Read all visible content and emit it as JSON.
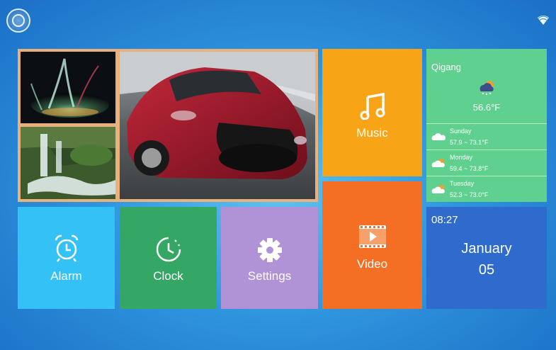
{
  "status_bar": {
    "home_icon": "circle-button-icon",
    "wifi_icon": "wifi-icon"
  },
  "gallery": {
    "photos": [
      "water-splash",
      "waterfall",
      "red-sports-car"
    ]
  },
  "tiles": {
    "music": {
      "label": "Music",
      "icon": "music-note-icon",
      "color": "#f7a416"
    },
    "video": {
      "label": "Video",
      "icon": "film-play-icon",
      "color": "#f46f24"
    },
    "alarm": {
      "label": "Alarm",
      "icon": "alarm-clock-icon",
      "color": "#33c1f6"
    },
    "clock": {
      "label": "Clock",
      "icon": "clock-icon",
      "color": "#34a765"
    },
    "settings": {
      "label": "Settings",
      "icon": "gear-icon",
      "color": "#b092d6"
    }
  },
  "weather": {
    "city": "Qigang",
    "current_temp": "56.6°F",
    "current_icon": "cloud-snow-icon",
    "forecast": [
      {
        "day": "Sunday",
        "range": "57.9 ~ 73.1°F"
      },
      {
        "day": "Monday",
        "range": "59.4 ~ 73.8°F"
      },
      {
        "day": "Tuesday",
        "range": "52.3 ~ 73.0°F"
      }
    ]
  },
  "datetime": {
    "time": "08:27",
    "month": "January",
    "day": "05"
  }
}
